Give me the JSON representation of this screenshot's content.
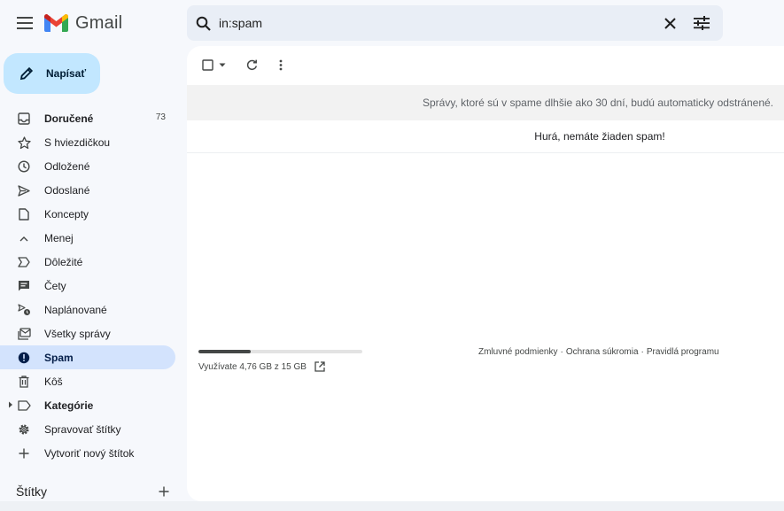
{
  "app": {
    "name": "Gmail"
  },
  "search": {
    "query": "in:spam"
  },
  "compose": {
    "label": "Napísať"
  },
  "nav": {
    "items": [
      {
        "label": "Doručené",
        "count": "73"
      },
      {
        "label": "S hviezdičkou"
      },
      {
        "label": "Odložené"
      },
      {
        "label": "Odoslané"
      },
      {
        "label": "Koncepty"
      },
      {
        "label": "Menej"
      },
      {
        "label": "Dôležité"
      },
      {
        "label": "Čety"
      },
      {
        "label": "Naplánované"
      },
      {
        "label": "Všetky správy"
      },
      {
        "label": "Spam"
      },
      {
        "label": "Kôš"
      },
      {
        "label": "Kategórie"
      },
      {
        "label": "Spravovať štítky"
      },
      {
        "label": "Vytvoriť nový štítok"
      }
    ]
  },
  "labels": {
    "title": "Štítky"
  },
  "main": {
    "banner": "Správy, ktoré sú v spame dlhšie ako 30 dní, budú automaticky odstránené.",
    "empty_message": "Hurá, nemáte žiaden spam!"
  },
  "storage": {
    "text": "Využívate 4,76 GB z 15 GB",
    "used_fraction": 0.317
  },
  "footer": {
    "terms": "Zmluvné podmienky",
    "privacy": "Ochrana súkromia",
    "policies": "Pravidlá programu",
    "separator": "·"
  },
  "colors": {
    "accent": "#c2e7ff",
    "active_nav": "#d3e3fd",
    "search_bg": "#e9eef6",
    "page_bg": "#f6f8fc"
  }
}
